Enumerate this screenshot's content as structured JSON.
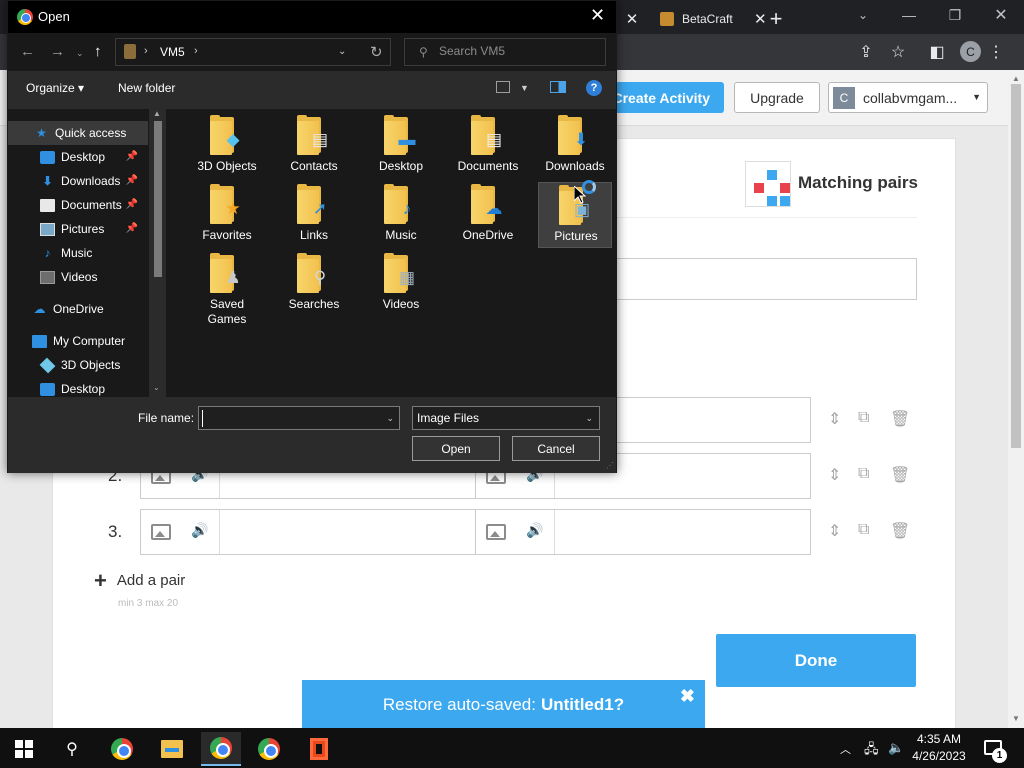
{
  "chrome": {
    "tab_close_glyph": "✕",
    "tabs": [
      {
        "title": "BetaCraft",
        "close": "✕"
      }
    ],
    "new_tab_glyph": "+",
    "profile_initial": "C"
  },
  "page": {
    "create_activity": "Create Activity",
    "upgrade": "Upgrade",
    "account": {
      "initial": "C",
      "name": "collabvmgam..."
    },
    "activity_type": "Matching pairs",
    "pairs": [
      {
        "number": "2."
      },
      {
        "number": "3."
      }
    ],
    "add_pair": "Add a pair",
    "minmax": "min 3   max 20",
    "done": "Done",
    "restore": {
      "prefix": "Restore auto-saved:",
      "name": "Untitled1?",
      "close": "✖"
    },
    "colors": {
      "accent": "#3ba8ef"
    }
  },
  "dialog": {
    "title": "Open",
    "address": {
      "segments": [
        "VM5"
      ]
    },
    "search_placeholder": "Search VM5",
    "organize": "Organize ▾",
    "new_folder": "New folder",
    "help": "?",
    "nav_pane": [
      {
        "label": "Quick access",
        "icon": "star-icon",
        "pinned": false
      },
      {
        "label": "Desktop",
        "icon": "desktop-icon",
        "pinned": true
      },
      {
        "label": "Downloads",
        "icon": "download-icon",
        "pinned": true
      },
      {
        "label": "Documents",
        "icon": "documents-icon",
        "pinned": true
      },
      {
        "label": "Pictures",
        "icon": "pictures-icon",
        "pinned": true
      },
      {
        "label": "Music",
        "icon": "music-icon",
        "pinned": false
      },
      {
        "label": "Videos",
        "icon": "videos-icon",
        "pinned": false
      },
      {
        "label": "OneDrive",
        "icon": "onedrive-icon",
        "pinned": false
      },
      {
        "label": "My Computer",
        "icon": "computer-icon",
        "pinned": false
      },
      {
        "label": "3D Objects",
        "icon": "cube-icon",
        "pinned": false
      },
      {
        "label": "Desktop",
        "icon": "desktop-icon",
        "pinned": false
      }
    ],
    "folders": [
      {
        "label": "3D Objects",
        "icon": "cube-icon"
      },
      {
        "label": "Contacts",
        "icon": "contact-card-icon"
      },
      {
        "label": "Desktop",
        "icon": "desktop-icon"
      },
      {
        "label": "Documents",
        "icon": "documents-icon"
      },
      {
        "label": "Downloads",
        "icon": "download-arrow-icon"
      },
      {
        "label": "Favorites",
        "icon": "star-icon"
      },
      {
        "label": "Links",
        "icon": "link-arrow-icon"
      },
      {
        "label": "Music",
        "icon": "music-note-icon"
      },
      {
        "label": "OneDrive",
        "icon": "cloud-icon"
      },
      {
        "label": "Pictures",
        "icon": "picture-icon",
        "selected": true
      },
      {
        "label": "Saved Games",
        "icon": "chess-pawn-icon"
      },
      {
        "label": "Searches",
        "icon": "magnifier-icon"
      },
      {
        "label": "Videos",
        "icon": "film-icon"
      }
    ],
    "file_name_label": "File name:",
    "file_name_value": "",
    "file_type": "Image Files",
    "open": "Open",
    "cancel": "Cancel"
  },
  "taskbar": {
    "time": "4:35 AM",
    "date": "4/26/2023",
    "notifications": "1"
  }
}
